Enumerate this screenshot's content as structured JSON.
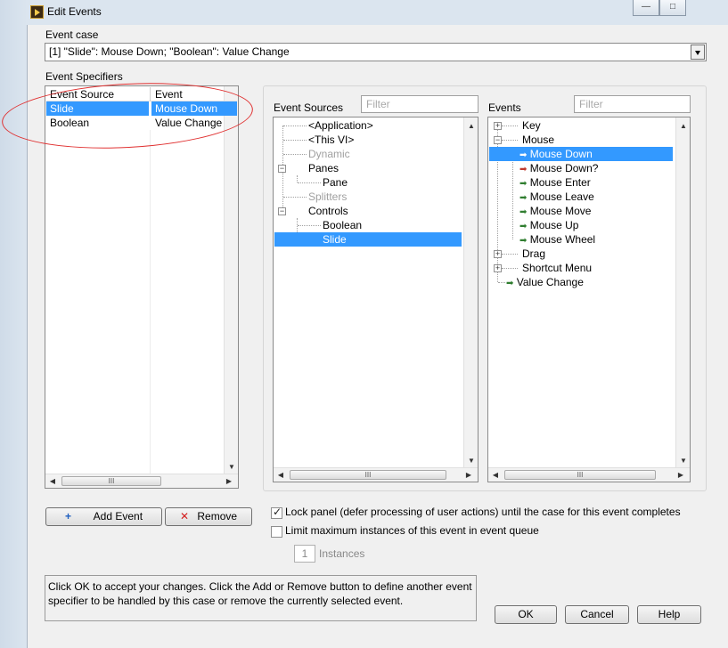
{
  "window": {
    "title": "Edit Events",
    "buttons": {
      "minimize": "—",
      "maximize": "□"
    }
  },
  "event_case": {
    "label": "Event case",
    "value": "[1] \"Slide\": Mouse Down;  \"Boolean\": Value Change"
  },
  "event_specifiers": {
    "label": "Event Specifiers",
    "columns": [
      "Event Source",
      "Event"
    ],
    "rows": [
      {
        "source": "Slide",
        "event": "Mouse Down",
        "selected": true
      },
      {
        "source": "Boolean",
        "event": "Value Change",
        "selected": false
      }
    ]
  },
  "event_sources": {
    "label": "Event Sources",
    "filter_placeholder": "Filter",
    "items": [
      {
        "label": "<Application>",
        "depth": 1,
        "disabled": false,
        "expandable": false
      },
      {
        "label": "<This VI>",
        "depth": 1,
        "disabled": false,
        "expandable": false
      },
      {
        "label": "Dynamic",
        "depth": 1,
        "disabled": true,
        "expandable": false
      },
      {
        "label": "Panes",
        "depth": 0,
        "disabled": false,
        "expandable": true,
        "expanded": true
      },
      {
        "label": "Pane",
        "depth": 2,
        "disabled": false,
        "expandable": false
      },
      {
        "label": "Splitters",
        "depth": 1,
        "disabled": true,
        "expandable": false
      },
      {
        "label": "Controls",
        "depth": 0,
        "disabled": false,
        "expandable": true,
        "expanded": true
      },
      {
        "label": "Boolean",
        "depth": 2,
        "disabled": false,
        "expandable": false
      },
      {
        "label": "Slide",
        "depth": 2,
        "disabled": false,
        "expandable": false,
        "selected": true
      }
    ]
  },
  "events": {
    "label": "Events",
    "filter_placeholder": "Filter",
    "items": [
      {
        "label": "Key",
        "kind": "group",
        "expanded": false
      },
      {
        "label": "Mouse",
        "kind": "group",
        "expanded": true
      },
      {
        "label": "Mouse Down",
        "kind": "event",
        "selected": true
      },
      {
        "label": "Mouse Down?",
        "kind": "filter-event"
      },
      {
        "label": "Mouse Enter",
        "kind": "event"
      },
      {
        "label": "Mouse Leave",
        "kind": "event"
      },
      {
        "label": "Mouse Move",
        "kind": "event"
      },
      {
        "label": "Mouse Up",
        "kind": "event"
      },
      {
        "label": "Mouse Wheel",
        "kind": "event"
      },
      {
        "label": "Drag",
        "kind": "group",
        "expanded": false
      },
      {
        "label": "Shortcut Menu",
        "kind": "group",
        "expanded": false
      },
      {
        "label": "Value Change",
        "kind": "top-event"
      }
    ]
  },
  "actions": {
    "add_event": "Add Event",
    "remove": "Remove",
    "lock_panel_label": "Lock panel (defer processing of user actions) until the case for this event completes",
    "lock_panel_checked": true,
    "limit_label": "Limit maximum instances of this event in event queue",
    "limit_checked": false,
    "instances_value": "1",
    "instances_label": "Instances"
  },
  "help_text": "Click OK to accept your changes.  Click the Add or Remove button to define another event specifier to be handled by this case or remove the currently selected event.",
  "footer": {
    "ok": "OK",
    "cancel": "Cancel",
    "help": "Help"
  },
  "scroll": {
    "up": "▲",
    "down": "▼",
    "left": "◀",
    "right": "▶",
    "grip": "III"
  },
  "colors": {
    "selection": "#3399ff",
    "annotation": "#e03030"
  },
  "icons": {
    "add": "plus-icon",
    "remove": "x-icon",
    "event_arrow": "arrow-right-icon"
  }
}
